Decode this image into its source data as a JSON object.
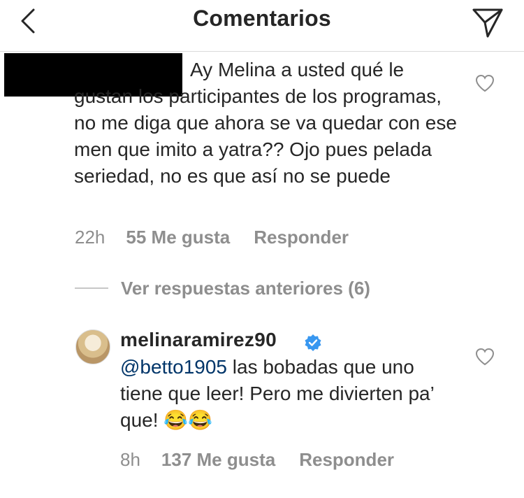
{
  "header": {
    "title": "Comentarios",
    "back_icon": "chevron-left-icon",
    "send_icon": "paper-plane-icon"
  },
  "comments": [
    {
      "text_first_line": "Ay Melina a usted qué le",
      "text_rest": "gustan los participantes de los programas, no me diga que ahora se va quedar con ese men que imito a yatra?? Ojo pues pelada seriedad, no es que así no se puede",
      "time": "22h",
      "likes": "55 Me gusta",
      "reply_label": "Responder"
    }
  ],
  "view_replies": "Ver respuestas anteriores (6)",
  "reply": {
    "username": "melinaramirez90",
    "mention": "@betto1905",
    "text": "las bobadas que uno tiene que leer! Pero me divierten pa’ que!",
    "emojis": "😂😂",
    "time": "8h",
    "likes": "137 Me gusta",
    "reply_label": "Responder"
  },
  "colors": {
    "text": "#262626",
    "meta": "#8e8e8e",
    "mention": "#003569",
    "verified": "#3897f0"
  }
}
